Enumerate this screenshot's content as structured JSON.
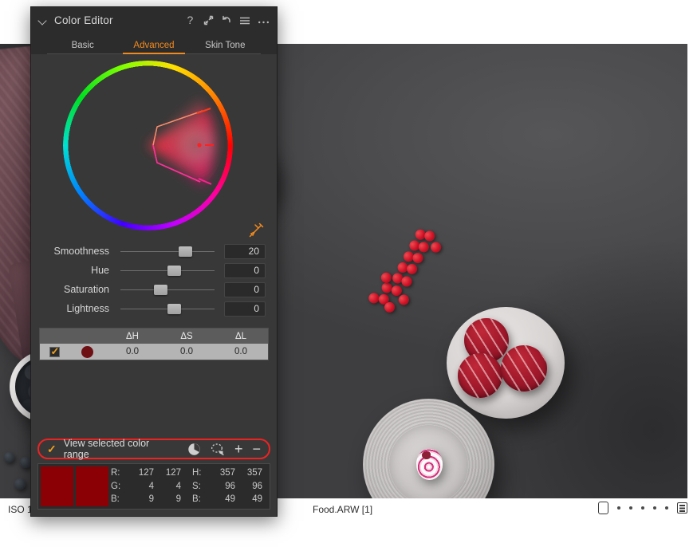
{
  "panel": {
    "title": "Color Editor",
    "collapse_icon": "chevron-down-icon",
    "header_icons": [
      "help-icon",
      "expand-icon",
      "reset-icon",
      "menu-icon",
      "more-icon"
    ],
    "tabs": [
      {
        "label": "Basic",
        "active": false
      },
      {
        "label": "Advanced",
        "active": true
      },
      {
        "label": "Skin Tone",
        "active": false
      }
    ],
    "accent_color": "#f08a1e",
    "picker_icon": "color-picker-icon",
    "sliders": [
      {
        "label": "Smoothness",
        "value": "20",
        "pos": 62
      },
      {
        "label": "Hue",
        "value": "0",
        "pos": 50
      },
      {
        "label": "Saturation",
        "value": "0",
        "pos": 36
      },
      {
        "label": "Lightness",
        "value": "0",
        "pos": 50
      }
    ],
    "delta_table": {
      "headers": [
        "ΔH",
        "ΔS",
        "ΔL"
      ],
      "rows": [
        {
          "enabled": true,
          "swatch_color": "#6e0f14",
          "dH": "0.0",
          "dS": "0.0",
          "dL": "0.0"
        }
      ]
    },
    "range_bar": {
      "checked": true,
      "check_glyph": "✓",
      "label": "View selected color range",
      "icons": [
        "color-range-pie-icon",
        "lasso-picker-icon"
      ],
      "add_label": "+",
      "remove_label": "−",
      "highlight_color": "#ef2222"
    },
    "readout": {
      "swatch_color": "#8b0004",
      "rows": [
        {
          "label": "R:",
          "v1": "127",
          "v2": "127",
          "label2": "H:",
          "v3": "357",
          "v4": "357"
        },
        {
          "label": "G:",
          "v1": "4",
          "v2": "4",
          "label2": "S:",
          "v3": "96",
          "v4": "96"
        },
        {
          "label": "B:",
          "v1": "9",
          "v2": "9",
          "label2": "B:",
          "v3": "49",
          "v4": "49"
        }
      ]
    }
  },
  "statusbar": {
    "iso": "ISO 1",
    "filename": "Food.ARW [1]",
    "page_dots": 5,
    "icons": [
      "crop-rect-icon",
      "list-view-icon"
    ]
  },
  "viewer": {
    "image_alt": "Food.ARW overhead photo of raspberries, blueberries, red currants, macarons and meringues on a dark grey surface"
  }
}
